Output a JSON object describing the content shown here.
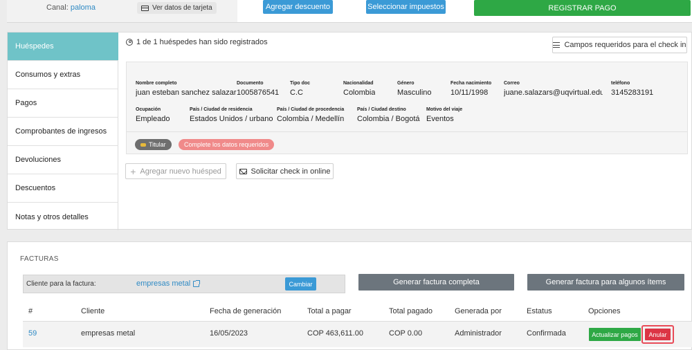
{
  "top": {
    "canal_label": "Canal:",
    "canal_value": "paloma",
    "card_button": "Ver datos de tarjeta",
    "discount_button": "Agregar descuento",
    "taxes_button": "Seleccionar impuestos",
    "register_button": "REGISTRAR PAGO"
  },
  "sidebar": {
    "items": [
      {
        "label": "Huéspedes"
      },
      {
        "label": "Consumos y extras"
      },
      {
        "label": "Pagos"
      },
      {
        "label": "Comprobantes de ingresos"
      },
      {
        "label": "Devoluciones"
      },
      {
        "label": "Descuentos"
      },
      {
        "label": "Notas y otros detalles"
      }
    ]
  },
  "guests": {
    "registered_text": "1 de 1 huéspedes han sido registrados",
    "required_fields_button": "Campos requeridos para el check in",
    "fields": {
      "nombre_label": "Nombre completo",
      "nombre": "juan esteban sanchez salazar",
      "documento_label": "Documento",
      "documento": "1005876541",
      "tipo_doc_label": "Tipo doc",
      "tipo_doc": "C.C",
      "nacionalidad_label": "Nacionalidad",
      "nacionalidad": "Colombia",
      "genero_label": "Género",
      "genero": "Masculino",
      "nacimiento_label": "Fecha nacimiento",
      "nacimiento": "10/11/1998",
      "correo_label": "Correo",
      "correo": "juane.salazars@uqvirtual.edu.co",
      "telefono_label": "teléfono",
      "telefono": "3145283191",
      "ocupacion_label": "Ocupación",
      "ocupacion": "Empleado",
      "residencia_label": "País / Ciudad de residencia",
      "residencia": "Estados Unidos / urbano",
      "procedencia_label": "País / Ciudad de procedencia",
      "procedencia": "Colombia / Medellín",
      "destino_label": "País / Ciudad destino",
      "destino": "Colombia / Bogotá",
      "motivo_label": "Motivo del viaje",
      "motivo": "Eventos"
    },
    "holder_badge": "Titular",
    "incomplete_badge": "Complete los datos requeridos",
    "add_guest_button": "Agregar nuevo huésped",
    "online_checkin_button": "Solicitar check in online"
  },
  "invoices": {
    "title": "FACTURAS",
    "client_label": "Cliente para la factura:",
    "client_name": "empresas metal",
    "change_button": "Cambiar",
    "full_invoice_button": "Generar factura completa",
    "partial_invoice_button": "Generar factura para algunos ítems",
    "columns": [
      "#",
      "Cliente",
      "Fecha de generación",
      "Total a pagar",
      "Total pagado",
      "Generada por",
      "Estatus",
      "Opciones"
    ],
    "rows": [
      {
        "id": "59",
        "cliente": "empresas metal",
        "fecha": "16/05/2023",
        "total": "COP 463,611.00",
        "pagado": "COP 0.00",
        "generada_por": "Administrador",
        "estatus": "Confirmada",
        "update_button": "Actualizar pagos",
        "cancel_button": "Anular"
      }
    ]
  },
  "colors": {
    "accent_teal": "#6fc3c8",
    "primary_blue": "#3b9ad6",
    "success_green": "#2ea845",
    "danger_red": "#dc3545",
    "dark_gray": "#6c757d"
  }
}
